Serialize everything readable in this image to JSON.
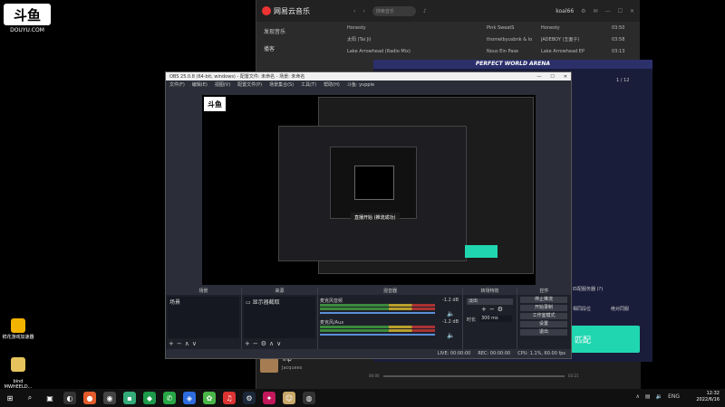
{
  "douyu": {
    "logo": "斗鱼",
    "url": "DOUYU.COM"
  },
  "desktop": {
    "icons": [
      {
        "label": "鲜花游戏加速器"
      },
      {
        "label": "bind\nMWHEELD..."
      }
    ]
  },
  "music": {
    "brand": "网易云音乐",
    "search_placeholder": "搜索音乐",
    "user": "koal66",
    "sidebar": [
      "发现音乐",
      "播客"
    ],
    "songs": [
      {
        "title": "Honesty",
        "artist": "Pink SweatS",
        "album": "Honesty",
        "time": "03:50"
      },
      {
        "title": "太阳 (Tai Ji)",
        "artist": "thomelbyusbnk & lo",
        "album": "JADEBOY (五面子)",
        "time": "03:58"
      },
      {
        "title": "Lake Arrowhead (Radio Mix)",
        "artist": "Nous Ein Pase",
        "album": "Lake Arrowhead EP",
        "time": "03:13"
      }
    ],
    "now_playing": {
      "title": "Trip",
      "artist": "Jacquees",
      "elapsed": "00:00",
      "total": "03:21"
    }
  },
  "game": {
    "title": "PERFECT WORLD ARENA",
    "page": "1 / 12",
    "start_label": "匹配",
    "option1": "相同段位",
    "option2": "绝对同服",
    "server_label": "匹配服务器 (?)"
  },
  "obs": {
    "title": "OBS 25.0.8 (64-bit, windows) - 配置文件: 未命名 - 场景: 未命名",
    "menu": [
      "文件(F)",
      "编辑(E)",
      "视图(V)",
      "配置文件(P)",
      "场景集合(S)",
      "工具(T)",
      "帮助(H)",
      "斗鱼: yuppie"
    ],
    "docks": {
      "scenes": {
        "header": "场景",
        "item": "场景"
      },
      "sources": {
        "header": "来源",
        "item": "显示器截取"
      },
      "mixer": {
        "header": "混音器",
        "channels": [
          {
            "name": "麦克风音频",
            "db": "-1.2 dB"
          },
          {
            "name": "麦克风/Aux",
            "db": "-1.2 dB"
          }
        ]
      },
      "transitions": {
        "header": "转场特效",
        "type": "淡出",
        "duration_label": "时长",
        "duration": "300 ms"
      },
      "controls": {
        "header": "控件",
        "buttons": [
          "停止推流",
          "开始录制",
          "工作室模式",
          "设置",
          "退出"
        ]
      }
    },
    "status": {
      "live": "LIVE: 00:00:00",
      "rec": "REC: 00:00:00",
      "cpu": "CPU: 1.1%, 60.00 fps"
    },
    "toast": "直播开始 (推流成功)"
  },
  "taskbar": {
    "lang": "ENG",
    "time": "12:32",
    "date": "2022/6/16"
  }
}
